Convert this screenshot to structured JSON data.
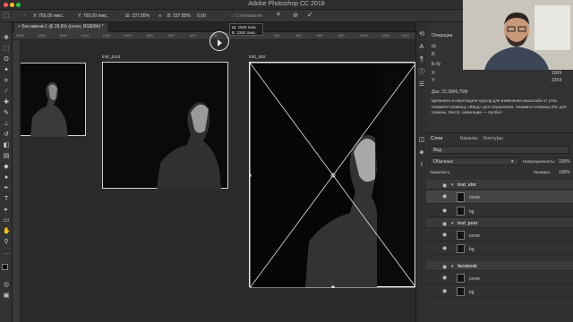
{
  "window": {
    "title": "Adobe Photoshop CC 2018"
  },
  "options_bar": {
    "x": "X: 769,00 пикс.",
    "y": "Y: 769,00 пикс.",
    "w": "Ш: 237,85%",
    "h": "В: 237,85%",
    "angle": "0,00",
    "interp": "○ Сглаживание"
  },
  "document_tab": "Без имени-1 @ 28,6% (cover, RGB/8#) *",
  "ruler": [
    "2000",
    "1800",
    "1600",
    "1400",
    "1200",
    "1000",
    "800",
    "600",
    "400",
    "200",
    "0",
    "200",
    "400",
    "600",
    "800",
    "1000",
    "1200",
    "1400"
  ],
  "artboards": {
    "insta": "inst_post",
    "story": "inst_stor"
  },
  "tooltip": {
    "line1": "Ш: 1509 пикс.",
    "line2": "В: 2262 пикс."
  },
  "properties": {
    "title": "Операции",
    "w_label": "Ш:",
    "h_label": "В:",
    "x_label": "X:",
    "y_label": "Y:",
    "bg_label": "Б-бу",
    "w_value": "1509",
    "h_value": "2264",
    "x_value": "X",
    "y_value": "Y:",
    "doc_size": "Док: 22,2M/6,75M",
    "hint": "Щелкните и перетащите курсор для изменения масштаба от угла. Нажмите клавишу «Ввод» для сохранения. Нажмите клавишу Esc для отмены. Инстр. навигации — пробел."
  },
  "layers_panel": {
    "tabs": [
      "Слои",
      "Каналы",
      "Контуры"
    ],
    "kind": "Вид",
    "blend": "Обычные",
    "opacity_label": "Непрозрачность:",
    "opacity": "100%",
    "lock_label": "Закрепить:",
    "fill_label": "Заливка:",
    "fill": "100%",
    "rows": [
      {
        "name": "inst_stor",
        "type": "group"
      },
      {
        "name": "cover",
        "type": "layer"
      },
      {
        "name": "bg",
        "type": "layer"
      },
      {
        "name": "inst_post",
        "type": "group"
      },
      {
        "name": "cover",
        "type": "layer"
      },
      {
        "name": "bg",
        "type": "layer"
      },
      {
        "name": "facebook",
        "type": "group"
      },
      {
        "name": "cover",
        "type": "layer"
      },
      {
        "name": "bg",
        "type": "layer"
      }
    ]
  },
  "colors": {
    "accent": "#ffffff",
    "bg": "#2b2b2b",
    "panel": "#323232"
  }
}
